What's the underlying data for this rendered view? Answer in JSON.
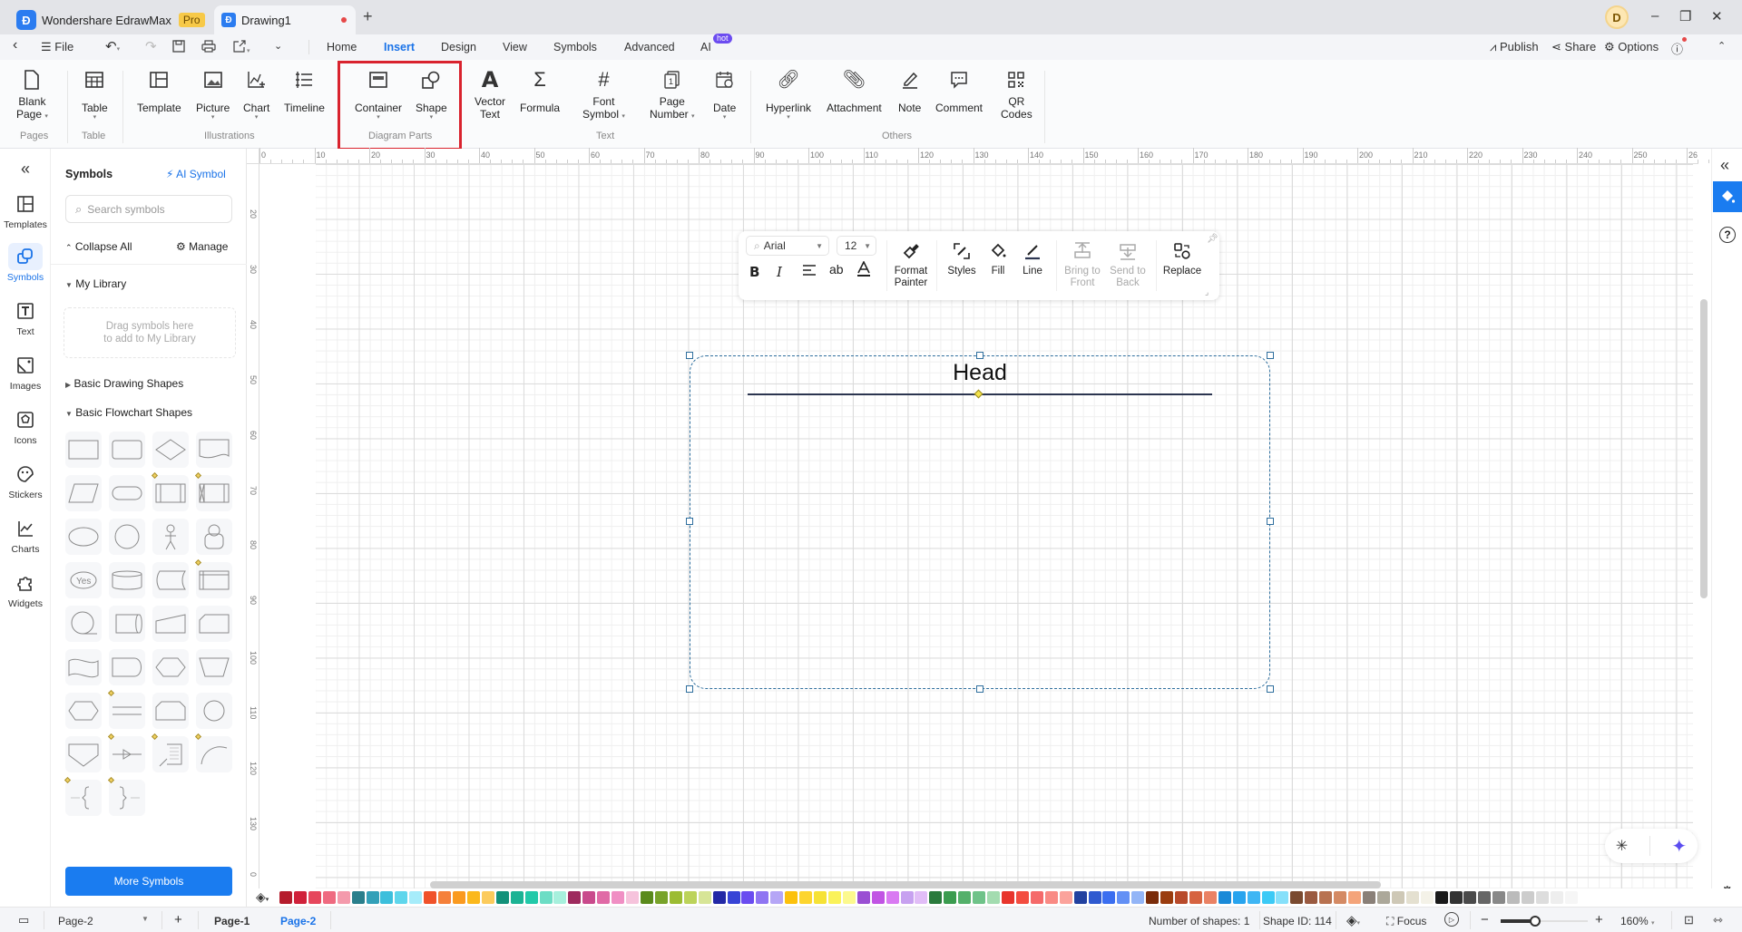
{
  "titlebar": {
    "app_name": "Wondershare EdrawMax",
    "app_badge": "Pro",
    "doc_tab": "Drawing1",
    "new_tab": "+",
    "avatar_letter": "D",
    "minimize": "–",
    "restore": "❐",
    "close": "✕"
  },
  "menubar": {
    "file": "File",
    "tabs": [
      "Home",
      "Insert",
      "Design",
      "View",
      "Symbols",
      "Advanced",
      "AI"
    ],
    "active_tab": "Insert",
    "ai_badge": "hot",
    "publish": "Publish",
    "share": "Share",
    "options": "Options"
  },
  "ribbon": {
    "groups": {
      "pages": "Pages",
      "table": "Table",
      "illustrations": "Illustrations",
      "diagram_parts": "Diagram Parts",
      "text": "Text",
      "others": "Others"
    },
    "buttons": {
      "blank_page": [
        "Blank",
        "Page"
      ],
      "table": "Table",
      "template": "Template",
      "picture": "Picture",
      "chart": "Chart",
      "timeline": "Timeline",
      "container": "Container",
      "shape": "Shape",
      "vector_text": [
        "Vector",
        "Text"
      ],
      "formula": "Formula",
      "font_symbol": [
        "Font",
        "Symbol"
      ],
      "page_number": [
        "Page",
        "Number"
      ],
      "date": "Date",
      "hyperlink": "Hyperlink",
      "attachment": "Attachment",
      "note": "Note",
      "comment": "Comment",
      "qr_codes": [
        "QR",
        "Codes"
      ]
    }
  },
  "leftnav": {
    "items": [
      {
        "label": "Templates"
      },
      {
        "label": "Symbols",
        "active": true
      },
      {
        "label": "Text"
      },
      {
        "label": "Images"
      },
      {
        "label": "Icons"
      },
      {
        "label": "Stickers"
      },
      {
        "label": "Charts"
      },
      {
        "label": "Widgets"
      }
    ]
  },
  "symbols_panel": {
    "title": "Symbols",
    "ai_symbol": "AI Symbol",
    "search_placeholder": "Search symbols",
    "collapse_all": "Collapse All",
    "manage": "Manage",
    "my_library": "My Library",
    "my_library_hint_1": "Drag symbols here",
    "my_library_hint_2": "to add to My Library",
    "basic_drawing_shapes": "Basic Drawing Shapes",
    "basic_flowchart_shapes": "Basic Flowchart Shapes",
    "more_symbols": "More Symbols",
    "flowchart_shapes": [
      "Process",
      "Rounded Process",
      "Decision",
      "Document",
      "Data",
      "Terminator",
      "Predefined Process",
      "Predefined Process 2",
      "Ellipse",
      "Circle",
      "Actor",
      "User",
      "Yes",
      "Stored Data",
      "Card Tape",
      "Internal Storage",
      "Sequential Data",
      "Direct Data",
      "Manual Input",
      "Loop Limit",
      "Punched Tape",
      "Delay",
      "Display",
      "Manual Operation",
      "Preparation",
      "Parallel Mode",
      "Card",
      "Connector",
      "Off-page Reference",
      "Link",
      "Annotation",
      "Arc",
      "Brace Left",
      "Brace Right"
    ]
  },
  "rulers": {
    "horizontal": [
      "0",
      "10",
      "20",
      "30",
      "40",
      "50",
      "60",
      "70",
      "80",
      "90",
      "100",
      "110",
      "120",
      "130",
      "140",
      "150",
      "160",
      "170",
      "180",
      "190",
      "200",
      "210",
      "220",
      "230",
      "240",
      "250",
      "26"
    ],
    "vertical": [
      "20",
      "30",
      "40",
      "50",
      "60",
      "70",
      "80",
      "90",
      "100",
      "110",
      "120",
      "130",
      "0"
    ]
  },
  "floating_toolbar": {
    "font": "Arial",
    "size": "12",
    "bold": "B",
    "italic": "I",
    "strikeab": "ab",
    "format_painter": [
      "Format",
      "Painter"
    ],
    "styles": "Styles",
    "fill": "Fill",
    "line": "Line",
    "bring_to_front": [
      "Bring to",
      "Front"
    ],
    "send_to_back": [
      "Send to",
      "Back"
    ],
    "replace": "Replace"
  },
  "canvas": {
    "container_title": "Head"
  },
  "palette": {
    "colors": [
      "#b51c2c",
      "#d0213a",
      "#e6475c",
      "#ef6a80",
      "#f49aac",
      "#2a7f8c",
      "#33a0b8",
      "#3cbfdc",
      "#5fd6ec",
      "#a6ecfa",
      "#f0522a",
      "#f5803a",
      "#fa9a20",
      "#fbb81c",
      "#fccb5c",
      "#13917a",
      "#1cb394",
      "#22c9a9",
      "#6dddc5",
      "#a7f0dd",
      "#9e2b5e",
      "#c94a8c",
      "#e06aa6",
      "#f08fc4",
      "#f6c3dc",
      "#5a8a1c",
      "#78a32a",
      "#9cbc33",
      "#bcd35a",
      "#d7e597",
      "#2329a6",
      "#3744d6",
      "#6a4cf0",
      "#8f75f2",
      "#b5a6f6",
      "#fcc10c",
      "#fdd52f",
      "#f6e236",
      "#faf25a",
      "#fcf98e",
      "#9a4fd3",
      "#c154e4",
      "#d97af2",
      "#c7a1f0",
      "#e1bdf7",
      "#2a7a3c",
      "#3b9c4f",
      "#54b06a",
      "#6fc389",
      "#a3dcb0",
      "#e8352c",
      "#f34d40",
      "#f56a6a",
      "#f98a84",
      "#fba39c",
      "#2241a0",
      "#2f5ad0",
      "#3b6ef0",
      "#6390f5",
      "#93b5f7",
      "#7a2c0a",
      "#9a3c0e",
      "#b84a2a",
      "#d66340",
      "#ea8264",
      "#1a8ad8",
      "#28a4ee",
      "#3fb6f4",
      "#3ccaf6",
      "#86e0fa",
      "#7a4a30",
      "#9a5a40",
      "#b87250",
      "#d48a64",
      "#f4a47a",
      "#8a8078",
      "#aca89a",
      "#cec8b6",
      "#e4e0d0",
      "#f4f2e8",
      "#1a1a1a",
      "#333333",
      "#4a4a4a",
      "#666666",
      "#888888",
      "#bbbbbb",
      "#cccccc",
      "#dddddd",
      "#eeeeee",
      "#f6f6f6"
    ]
  },
  "statusbar": {
    "page_select": "Page-2",
    "add_page": "+",
    "pages": [
      "Page-1",
      "Page-2"
    ],
    "active_page": "Page-2",
    "shape_count": "Number of shapes: 1",
    "shape_id": "Shape ID: 114",
    "focus": "Focus",
    "zoom_minus": "−",
    "zoom_plus": "+",
    "zoom_level": "160%",
    "zoom_fraction": 0.4
  }
}
